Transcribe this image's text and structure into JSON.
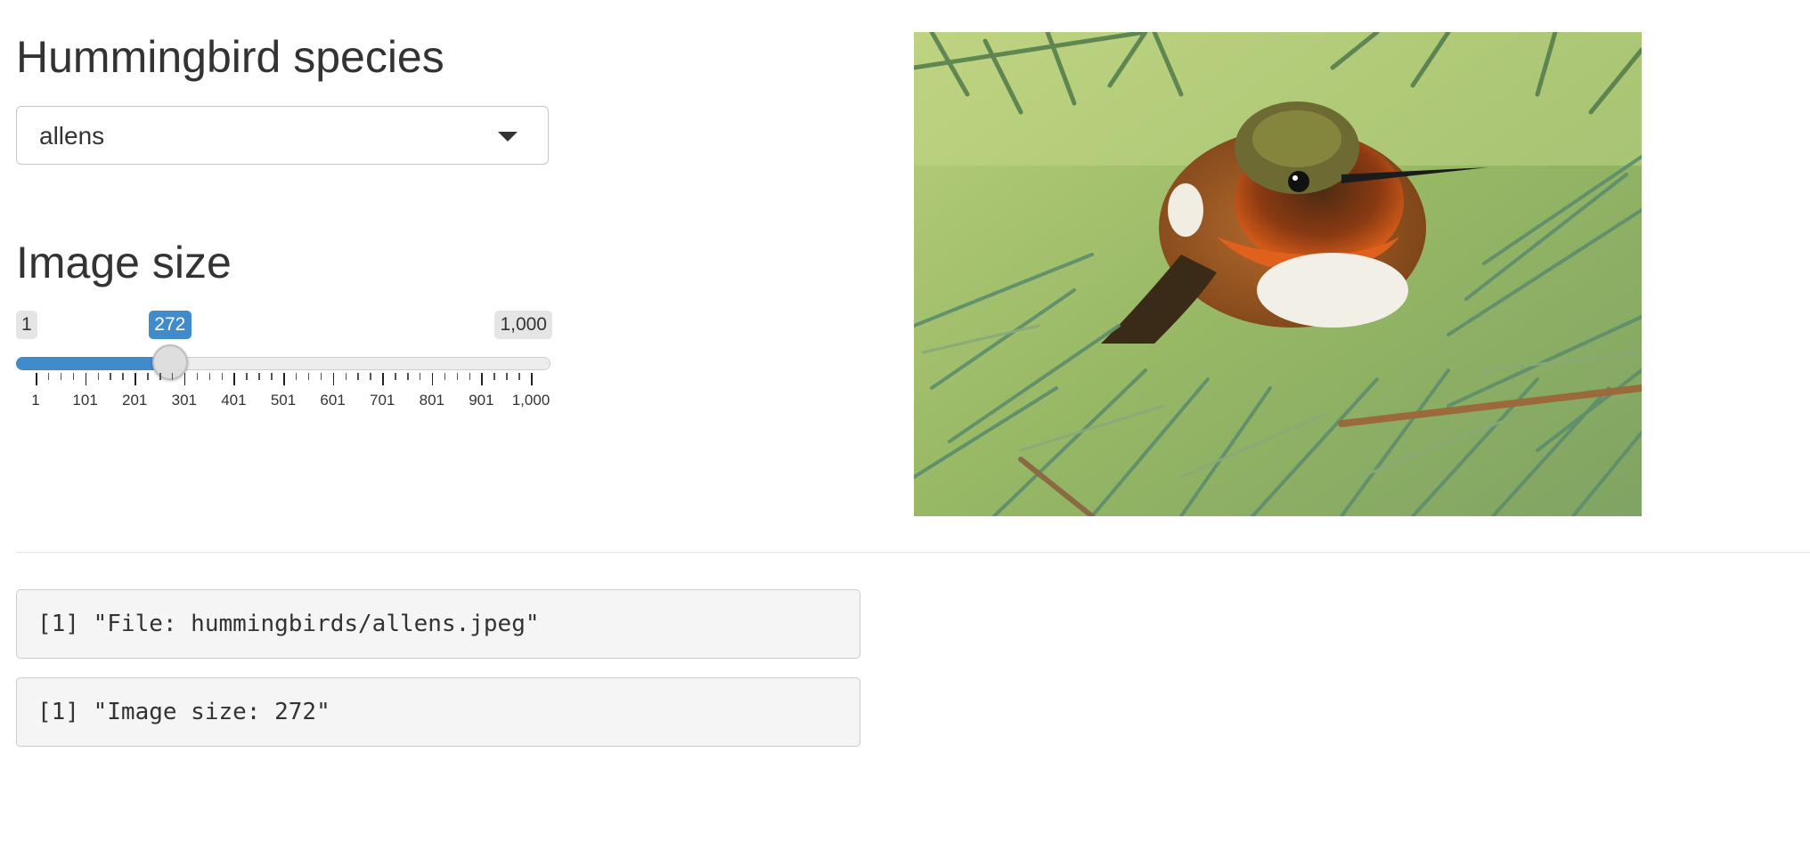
{
  "species_section": {
    "heading": "Hummingbird species",
    "select": {
      "value": "allens"
    }
  },
  "size_section": {
    "heading": "Image size",
    "slider": {
      "min_label": "1",
      "max_label": "1,000",
      "value_label": "272",
      "min": 1,
      "max": 1000,
      "value": 272,
      "tick_labels": [
        "1",
        "101",
        "201",
        "301",
        "401",
        "501",
        "601",
        "701",
        "801",
        "901",
        "1,000"
      ],
      "accent_color": "#428bca"
    }
  },
  "image": {
    "icon": "hummingbird-photo"
  },
  "outputs": {
    "file_text": "[1] \"File: hummingbirds/allens.jpeg\"",
    "size_text": "[1] \"Image size: 272\""
  }
}
